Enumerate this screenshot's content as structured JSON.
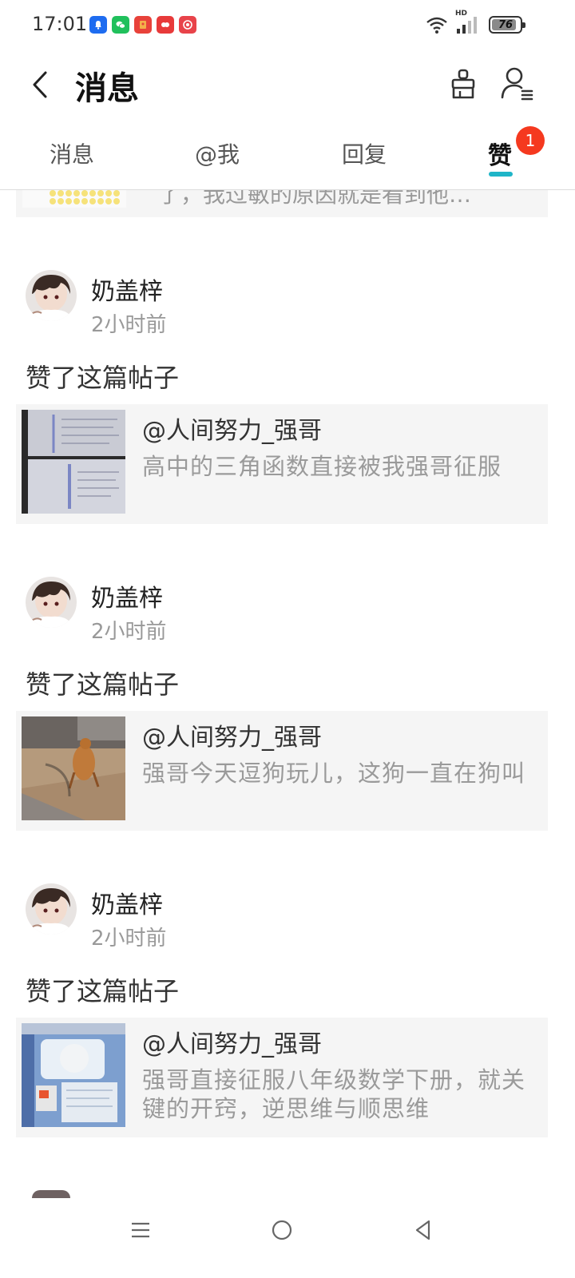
{
  "status_bar": {
    "time": "17:01",
    "battery": "76",
    "network": "HD",
    "notification_icons": [
      "bell-icon",
      "wechat-icon",
      "red-packet-icon",
      "app-icon",
      "record-icon"
    ]
  },
  "header": {
    "back_icon": "chevron-left-icon",
    "title": "消息",
    "clean_icon": "broom-icon",
    "profile_icon": "user-settings-icon"
  },
  "tabs": [
    {
      "label": "消息",
      "active": false
    },
    {
      "label": "@我",
      "active": false
    },
    {
      "label": "回复",
      "active": false
    },
    {
      "label": "赞",
      "active": true,
      "badge": "1"
    }
  ],
  "partial_item": {
    "snippet": "了，我过敏的原因就是看到他…"
  },
  "entries": [
    {
      "user": "奶盖梓",
      "time": "2小时前",
      "action": "赞了这篇帖子",
      "post_author": "@人间努力_强哥",
      "post_snippet": "高中的三角函数直接被我强哥征服"
    },
    {
      "user": "奶盖梓",
      "time": "2小时前",
      "action": "赞了这篇帖子",
      "post_author": "@人间努力_强哥",
      "post_snippet": "强哥今天逗狗玩儿，这狗一直在狗叫"
    },
    {
      "user": "奶盖梓",
      "time": "2小时前",
      "action": "赞了这篇帖子",
      "post_author": "@人间努力_强哥",
      "post_snippet": "强哥直接征服八年级数学下册，就关键的开窍，逆思维与顺思维"
    }
  ],
  "nav": {
    "menu_icon": "menu-icon",
    "home_icon": "home-circle-icon",
    "back_icon": "back-triangle-icon"
  },
  "colors": {
    "accent": "#1fb5c8",
    "badge": "#f5391f",
    "card_bg": "#f5f5f5"
  }
}
